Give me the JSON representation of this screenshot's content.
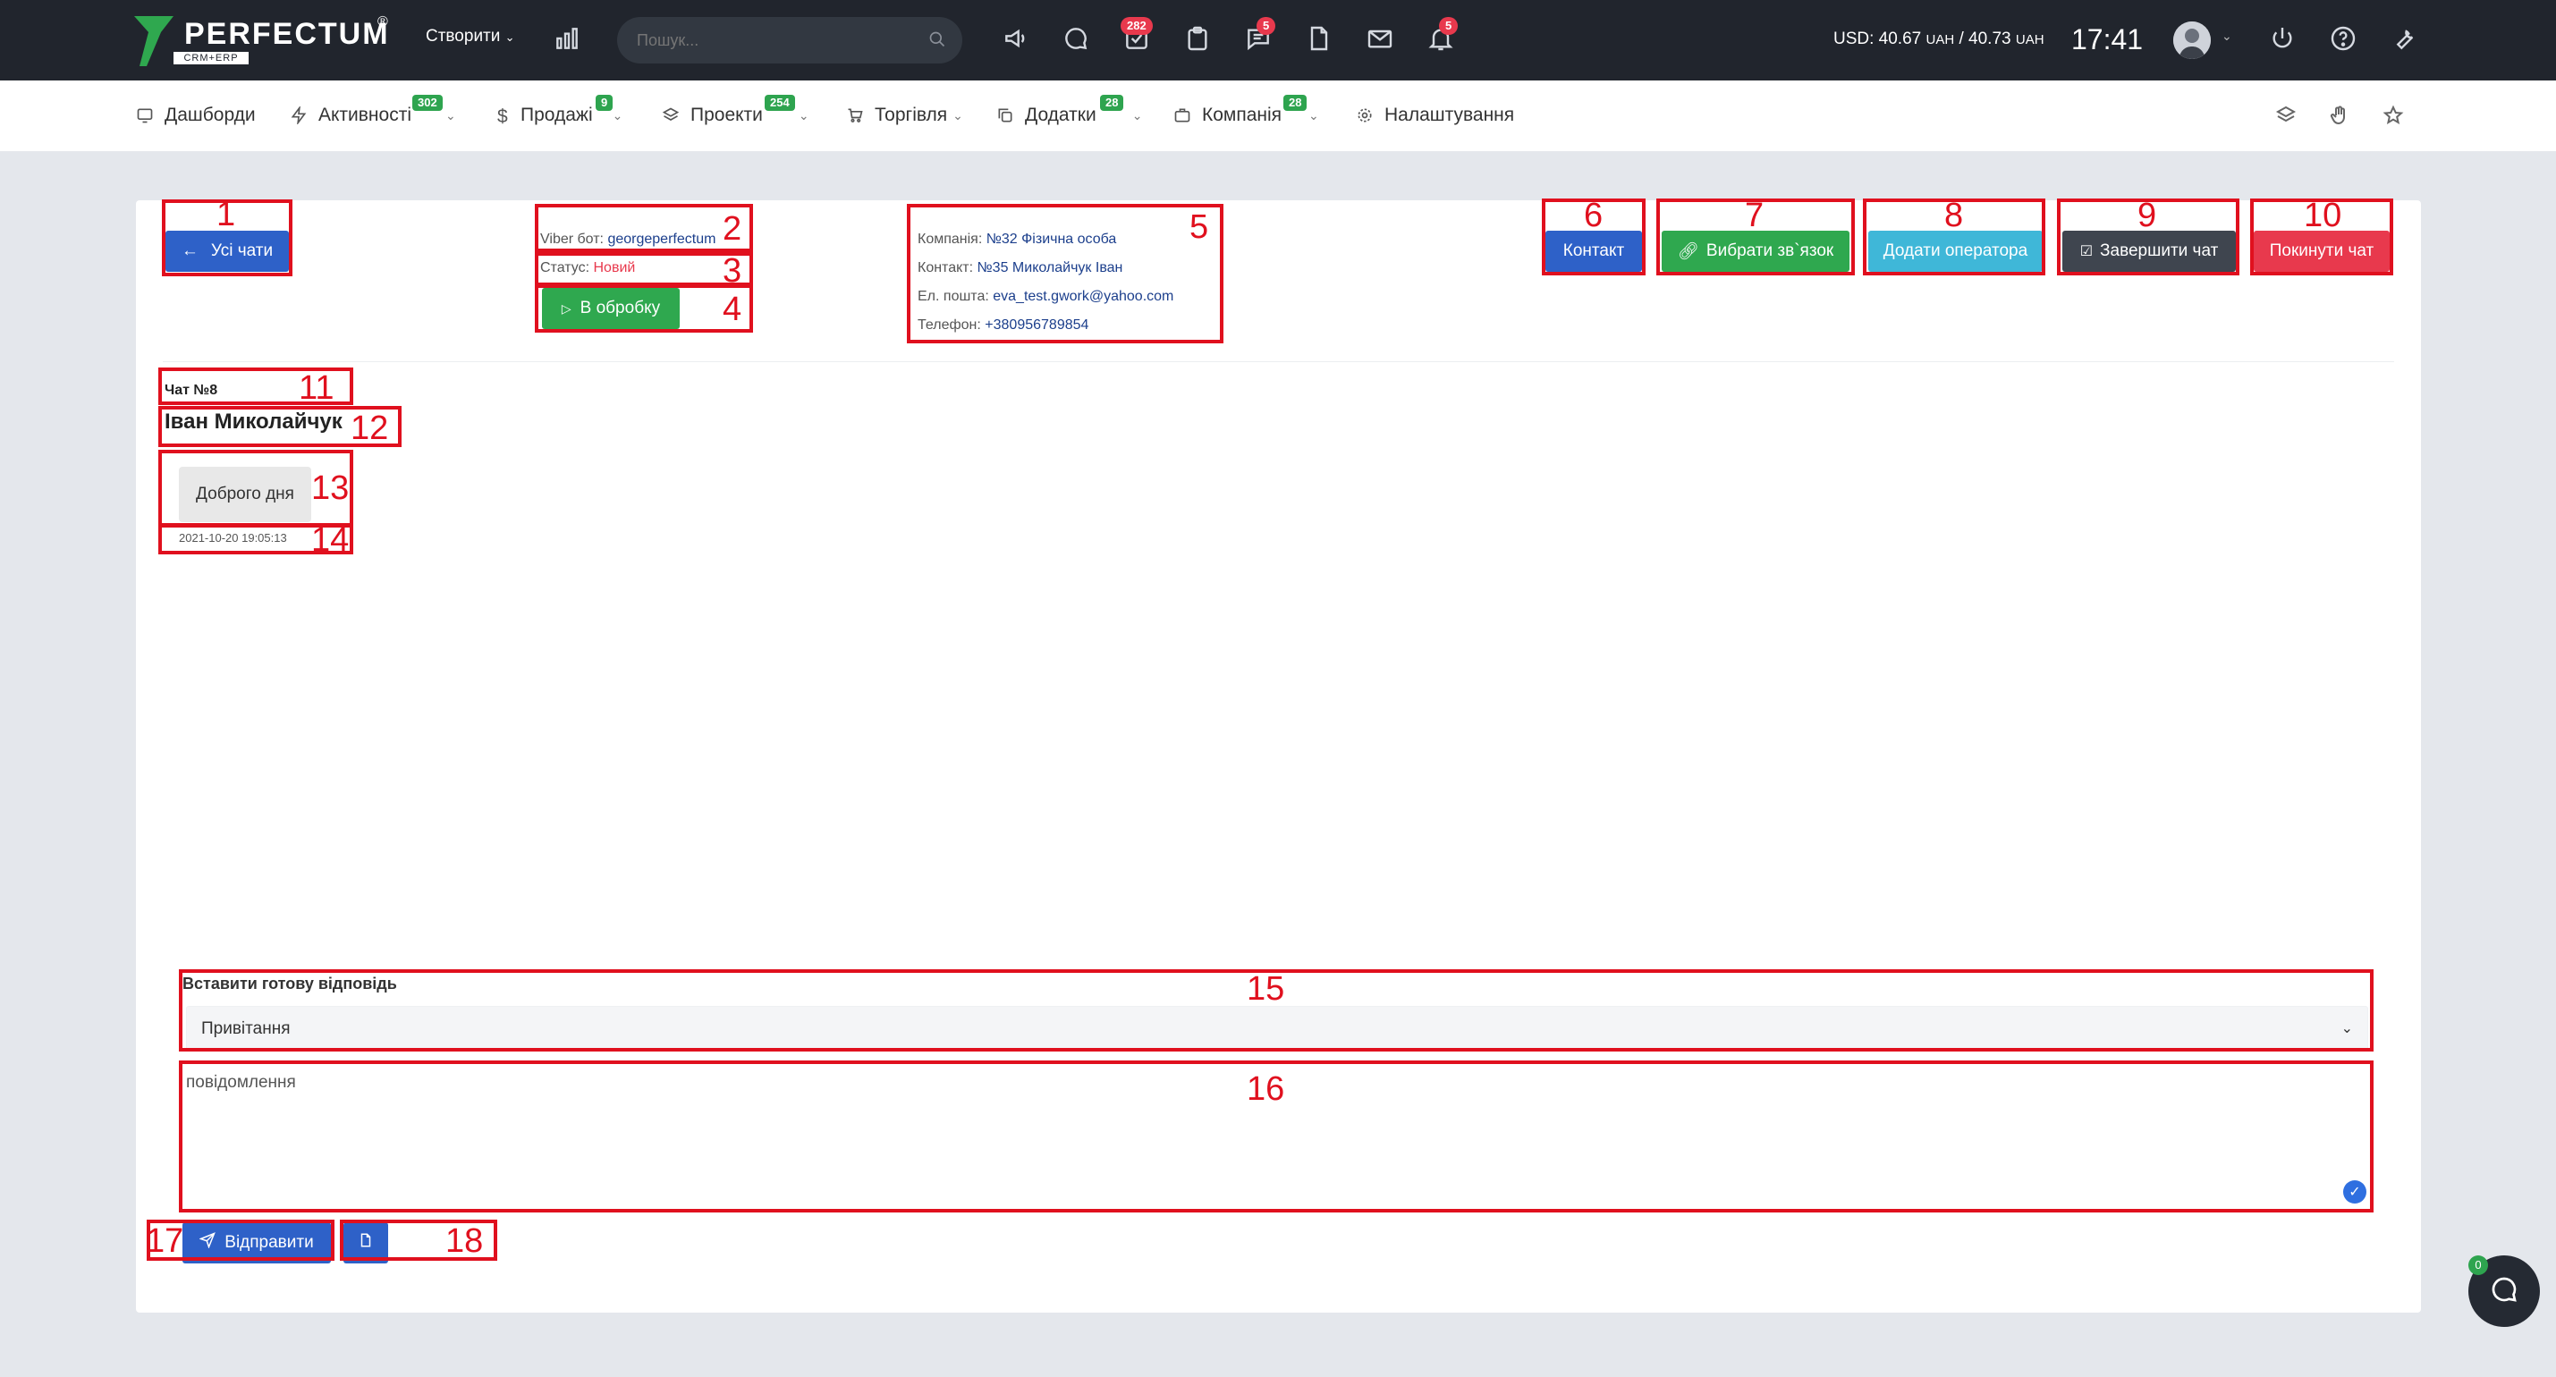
{
  "topbar": {
    "logo_text": "PERFECTUM",
    "logo_sub": "CRM+ERP",
    "logo_reg": "®",
    "create_label": "Створити",
    "search_placeholder": "Пошук...",
    "tasks_badge": "282",
    "chats_badge": "5",
    "notifications_badge": "5",
    "currency_prefix": "USD: 40.67",
    "currency_unit1": "UAH",
    "currency_sep": "/ 40.73",
    "currency_unit2": "UAH",
    "time": "17:41"
  },
  "nav": {
    "items": [
      {
        "label": "Дашборди"
      },
      {
        "label": "Активності",
        "badge": "302"
      },
      {
        "label": "Продажі",
        "badge": "9"
      },
      {
        "label": "Проекти",
        "badge": "254"
      },
      {
        "label": "Торгівля"
      },
      {
        "label": "Додатки",
        "badge": "28"
      },
      {
        "label": "Компанія",
        "badge": "28"
      },
      {
        "label": "Налаштування"
      }
    ]
  },
  "chat": {
    "all_chats_label": "Усі чати",
    "viber_label": "Viber бот:",
    "viber_bot": "georgeperfectum",
    "status_label": "Статус:",
    "status_value": "Новий",
    "process_label": "В обробку",
    "company_label": "Компанія:",
    "company_value": "№32 Фізична особа",
    "contact_label": "Контакт:",
    "contact_value": "№35 Миколайчук Іван",
    "email_label": "Ел. пошта:",
    "email_value": "eva_test.gwork@yahoo.com",
    "phone_label": "Телефон:",
    "phone_value": "+380956789854",
    "contact_btn": "Контакт",
    "link_btn": "Вибрати зв`язок",
    "add_operator_btn": "Додати оператора",
    "finish_btn": "Завершити чат",
    "leave_btn": "Покинути чат",
    "chat_number": "Чат №8",
    "client_name": "Іван Миколайчук",
    "message_text": "Доброго дня",
    "message_time": "2021-10-20 19:05:13",
    "ready_answer_label": "Вставити готову відповідь",
    "ready_answer_value": "Привітання",
    "message_placeholder": "повідомлення",
    "send_btn": "Відправити",
    "widget_badge": "0"
  },
  "annotations": [
    "1",
    "2",
    "3",
    "4",
    "5",
    "6",
    "7",
    "8",
    "9",
    "10",
    "11",
    "12",
    "13",
    "14",
    "15",
    "16",
    "17",
    "18"
  ],
  "colors": {
    "topbar_bg": "#21252d",
    "blue": "#2e61c8",
    "green": "#2fa84f",
    "cyan": "#3fb7d8",
    "dark": "#3f454f",
    "red": "#e8394d",
    "annotation_red": "#e0101e"
  }
}
